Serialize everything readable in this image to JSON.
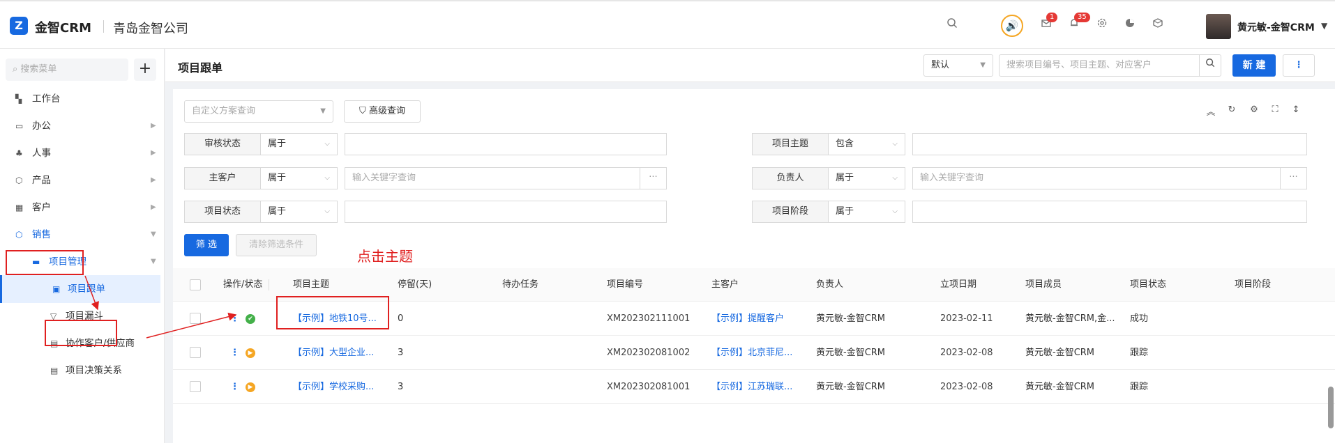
{
  "header": {
    "logo_mark": "Z",
    "brand": "金智CRM",
    "company": "青岛金智公司",
    "mail_badge": "1",
    "bell_badge": "35",
    "username": "黄元敏-金智CRM"
  },
  "sidebar": {
    "search_placeholder": "搜索菜单",
    "items": [
      {
        "label": "工作台",
        "icon": "dashboard-icon"
      },
      {
        "label": "办公",
        "icon": "office-icon"
      },
      {
        "label": "人事",
        "icon": "people-icon"
      },
      {
        "label": "产品",
        "icon": "product-icon"
      },
      {
        "label": "客户",
        "icon": "customer-icon"
      },
      {
        "label": "销售",
        "icon": "sales-icon"
      },
      {
        "label": "项目管理",
        "icon": "folder-icon"
      },
      {
        "label": "项目跟单",
        "icon": "doc-icon"
      },
      {
        "label": "项目漏斗",
        "icon": "funnel-icon"
      },
      {
        "label": "协作客户/供应商",
        "icon": "doc-icon"
      },
      {
        "label": "项目决策关系",
        "icon": "doc-icon"
      }
    ]
  },
  "page": {
    "title": "项目跟单",
    "view_select": "默认",
    "search_placeholder": "搜索项目编号、项目主题、对应客户",
    "new_label": "新 建",
    "more_label": "⋮"
  },
  "filters": {
    "scheme_placeholder": "自定义方案查询",
    "advanced_label": "高级查询",
    "rows": [
      {
        "label": "审核状态",
        "op": "属于",
        "placeholder": ""
      },
      {
        "label": "项目主题",
        "op": "包含",
        "placeholder": ""
      },
      {
        "label": "主客户",
        "op": "属于",
        "placeholder": "输入关键字查询"
      },
      {
        "label": "负责人",
        "op": "属于",
        "placeholder": "输入关键字查询"
      },
      {
        "label": "项目状态",
        "op": "属于",
        "placeholder": ""
      },
      {
        "label": "项目阶段",
        "op": "属于",
        "placeholder": ""
      }
    ],
    "filter_btn": "筛 选",
    "clear_btn": "清除筛选条件",
    "dots": "···"
  },
  "annotation": "点击主题",
  "table": {
    "columns": [
      "操作/状态",
      "项目主题",
      "停留(天)",
      "待办任务",
      "项目编号",
      "主客户",
      "负责人",
      "立项日期",
      "项目成员",
      "项目状态",
      "项目阶段"
    ],
    "rows": [
      {
        "status_color": "#43b049",
        "status_glyph": "✔",
        "subject": "【示例】地铁10号...",
        "stay": "0",
        "todo": "",
        "code": "XM202302111001",
        "customer": "【示例】提醒客户",
        "owner": "黄元敏-金智CRM",
        "date": "2023-02-11",
        "members": "黄元敏-金智CRM,金...",
        "state": "成功",
        "stage": ""
      },
      {
        "status_color": "#f5a623",
        "status_glyph": "▶",
        "subject": "【示例】大型企业...",
        "stay": "3",
        "todo": "",
        "code": "XM202302081002",
        "customer": "【示例】北京菲尼...",
        "owner": "黄元敏-金智CRM",
        "date": "2023-02-08",
        "members": "黄元敏-金智CRM",
        "state": "跟踪",
        "stage": ""
      },
      {
        "status_color": "#f5a623",
        "status_glyph": "▶",
        "subject": "【示例】学校采购...",
        "stay": "3",
        "todo": "",
        "code": "XM202302081001",
        "customer": "【示例】江苏瑞联...",
        "owner": "黄元敏-金智CRM",
        "date": "2023-02-08",
        "members": "黄元敏-金智CRM",
        "state": "跟踪",
        "stage": ""
      }
    ]
  },
  "colors": {
    "accent": "#1769e0",
    "annotation": "#e02020"
  }
}
